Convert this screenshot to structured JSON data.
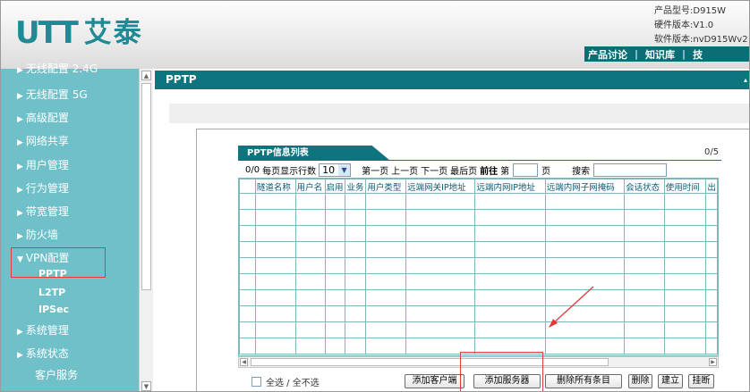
{
  "header": {
    "logo_mark": "UTT",
    "logo_cn": "艾泰",
    "device_info": [
      "产品型号:D915W",
      "硬件版本:V1.0",
      "软件版本:nvD915Wv2"
    ],
    "top_nav": [
      "产品讨论",
      "知识库",
      "技"
    ]
  },
  "sidebar": {
    "items": [
      {
        "label": "无线配置 2.4G"
      },
      {
        "label": "无线配置 5G"
      },
      {
        "label": "高级配置"
      },
      {
        "label": "网络共享"
      },
      {
        "label": "用户管理"
      },
      {
        "label": "行为管理"
      },
      {
        "label": "带宽管理"
      },
      {
        "label": "防火墙"
      },
      {
        "label": "VPN配置"
      },
      {
        "label": "系统管理"
      },
      {
        "label": "系统状态"
      },
      {
        "label": "客户服务"
      }
    ],
    "vpn_sub": [
      "PPTP",
      "L2TP",
      "IPSec"
    ]
  },
  "panel": {
    "title": "PPTP"
  },
  "list": {
    "title": "PPTP信息列表",
    "count": "0/5",
    "page_info": "0/0",
    "rows_label": "每页显示行数",
    "rows_value": "10",
    "first": "第一页",
    "prev": "上一页",
    "next": "下一页",
    "last": "最后页",
    "goto": "前往",
    "goto_prefix": "第",
    "goto_suffix": "页",
    "search": "搜索",
    "columns": [
      "",
      "隧道名称",
      "用户名",
      "启用",
      "业务",
      "用户类型",
      "远端网关IP地址",
      "远端内网IP地址",
      "远端内网子网掩码",
      "会话状态",
      "使用时间",
      "出"
    ]
  },
  "footer": {
    "select_all": "全选 / 全不选",
    "buttons": [
      "添加客户端",
      "添加服务器",
      "删除所有条目",
      "删除",
      "建立",
      "挂断"
    ]
  },
  "colors": {
    "teal_dark": "#0e747d",
    "sidebar": "#6fc0c9",
    "highlight": "#e03a3a"
  }
}
